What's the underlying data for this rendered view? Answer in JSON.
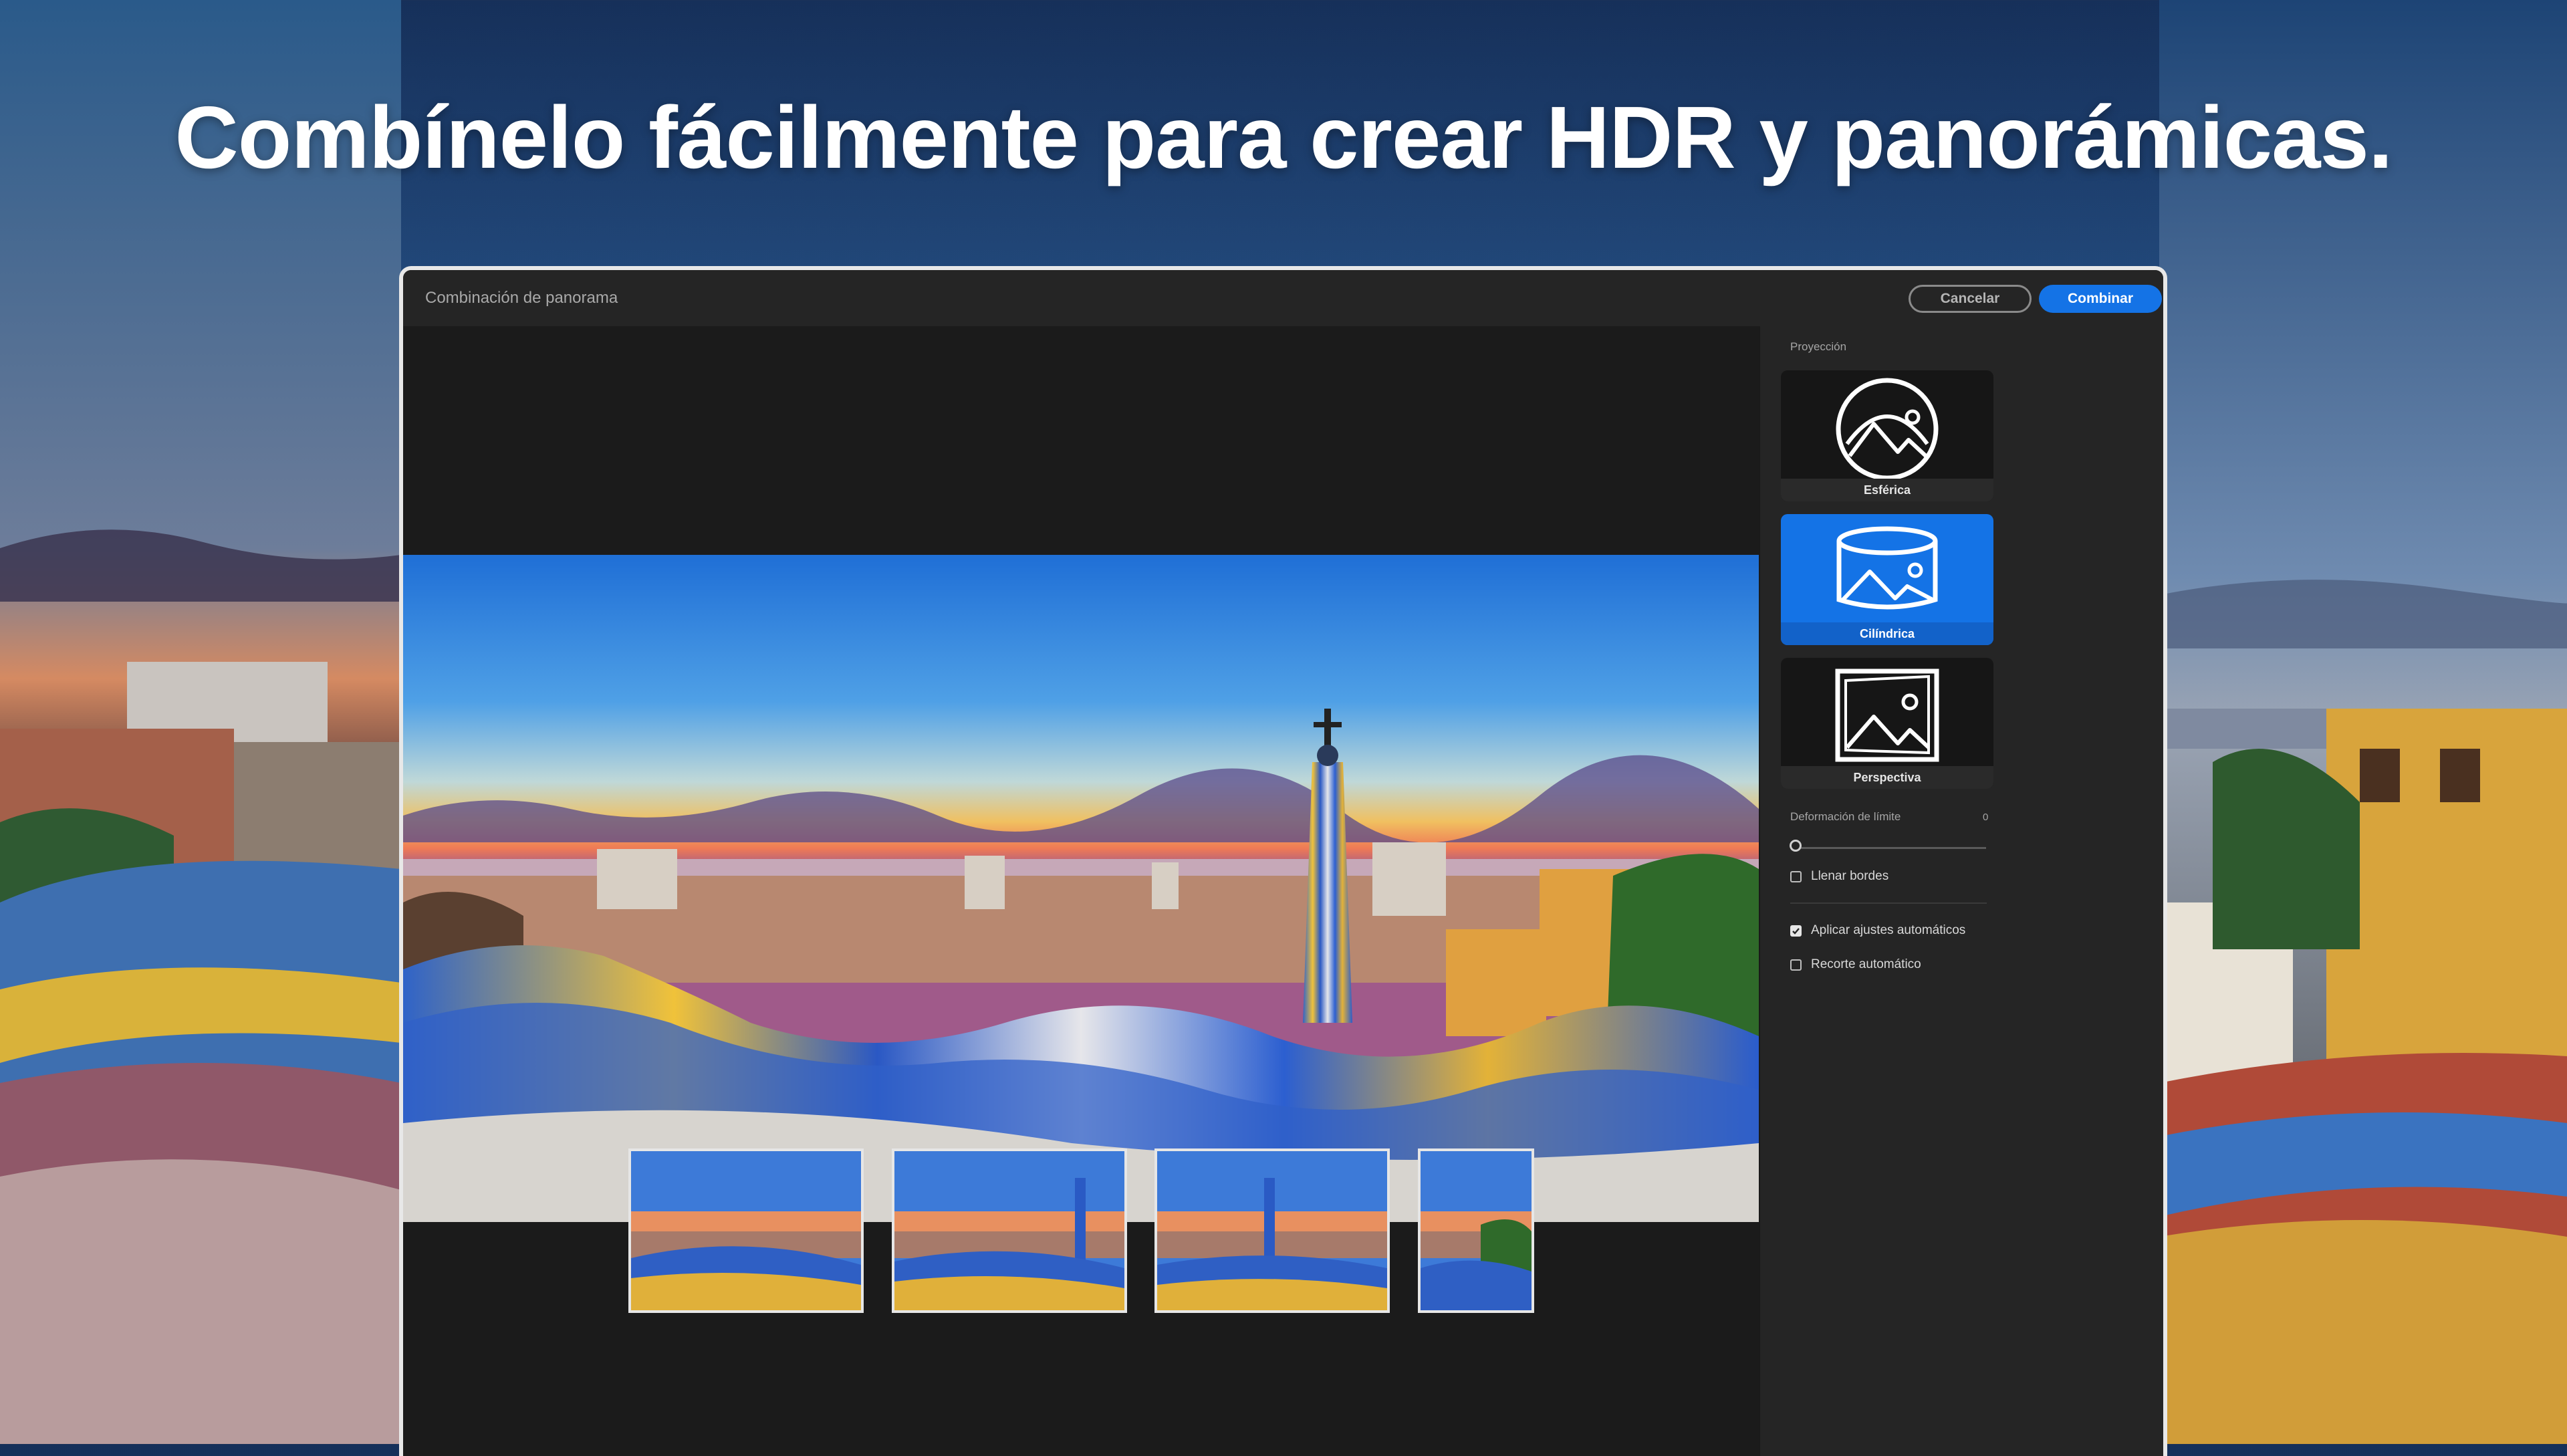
{
  "headline": "Combínelo fácilmente para crear HDR y panorámicas.",
  "window": {
    "title": "Combinación de panorama",
    "cancel_label": "Cancelar",
    "combine_label": "Combinar"
  },
  "panel": {
    "projection_label": "Proyección",
    "projections": [
      {
        "label": "Esférica",
        "icon": "sphere-icon",
        "selected": false
      },
      {
        "label": "Cilíndrica",
        "icon": "cylinder-icon",
        "selected": true
      },
      {
        "label": "Perspectiva",
        "icon": "perspective-icon",
        "selected": false
      }
    ],
    "boundary_warp": {
      "label": "Deformación de límite",
      "value": "0"
    },
    "fill_edges": {
      "label": "Llenar bordes",
      "checked": false
    },
    "auto_settings": {
      "label": "Aplicar ajustes automáticos",
      "checked": true
    },
    "auto_crop": {
      "label": "Recorte automático",
      "checked": false
    }
  },
  "colors": {
    "accent": "#1473e6",
    "panel_bg": "#252525",
    "canvas_bg": "#1b1b1b"
  }
}
